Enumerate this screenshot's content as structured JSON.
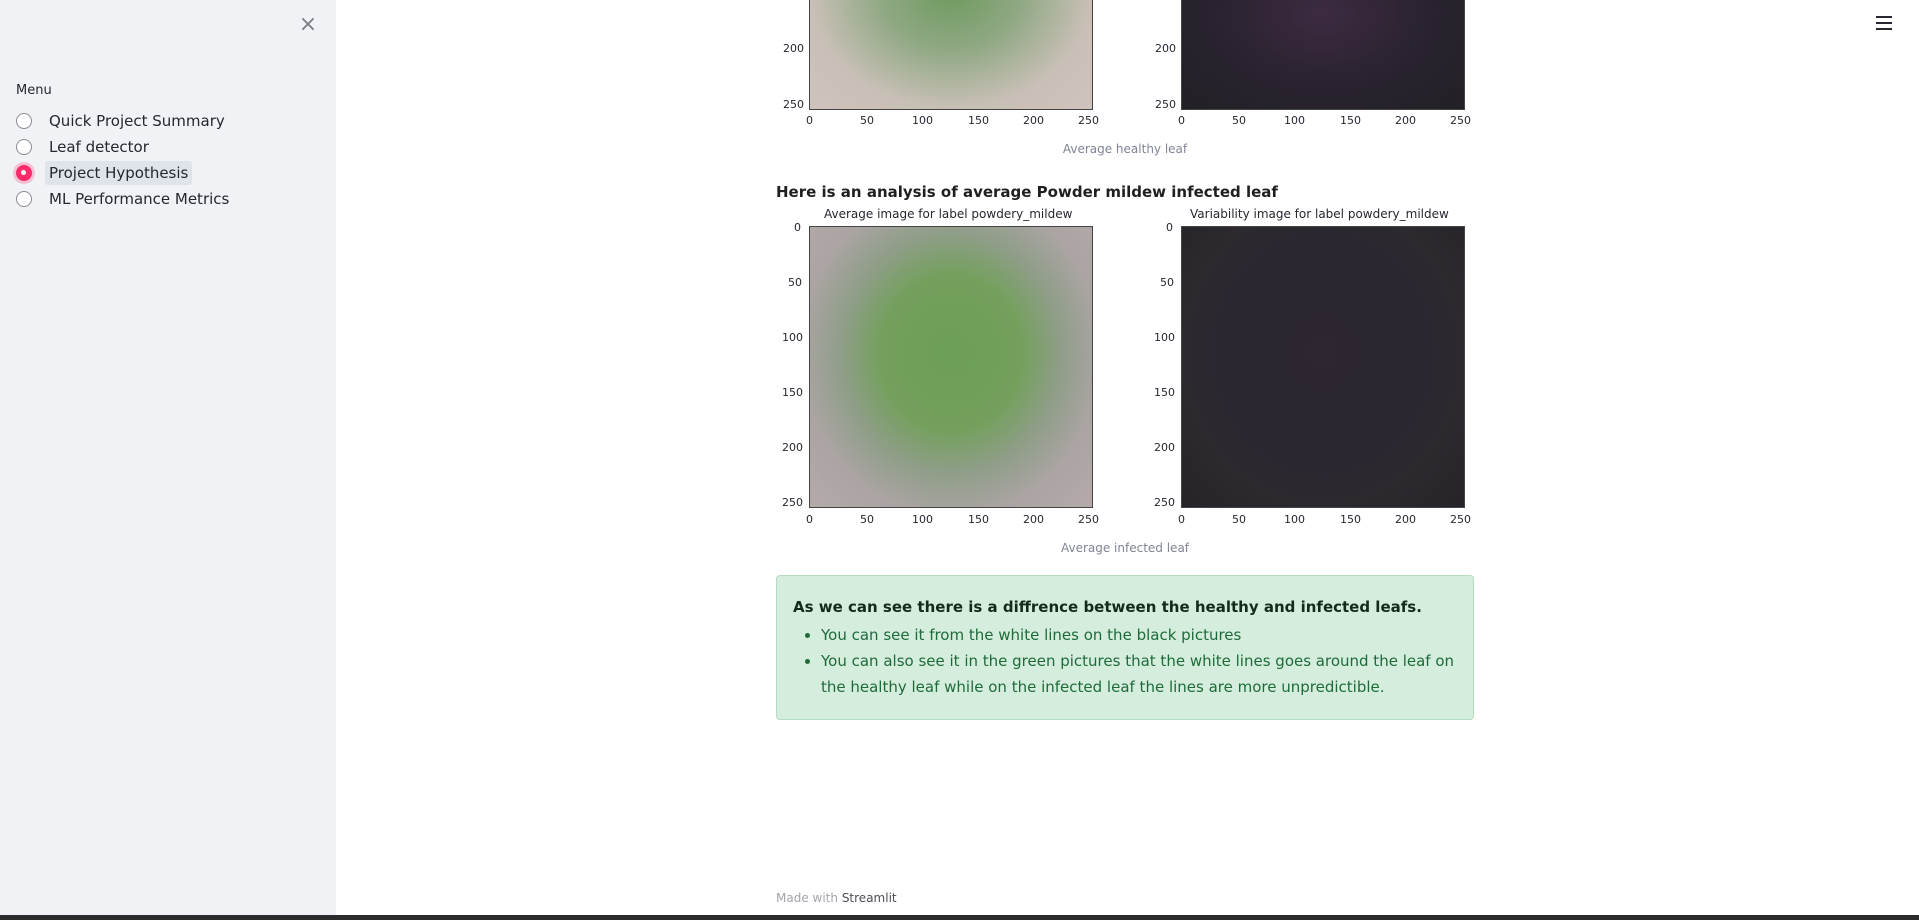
{
  "sidebar": {
    "close_icon": "close-icon",
    "menu_label": "Menu",
    "items": [
      {
        "label": "Quick Project Summary",
        "selected": false
      },
      {
        "label": "Leaf detector",
        "selected": false
      },
      {
        "label": "Project Hypothesis",
        "selected": true
      },
      {
        "label": "ML Performance Metrics",
        "selected": false
      }
    ]
  },
  "header": {
    "menu_icon": "hamburger-icon"
  },
  "main": {
    "healthy": {
      "caption": "Average healthy leaf",
      "ticks_y": [
        "200",
        "250"
      ],
      "ticks_x": [
        "0",
        "50",
        "100",
        "150",
        "200",
        "250"
      ]
    },
    "infected": {
      "heading": "Here is an analysis of average Powder mildew infected leaf",
      "left_title": "Average image for label powdery_mildew",
      "right_title": "Variability image for label powdery_mildew",
      "ticks_y": [
        "0",
        "50",
        "100",
        "150",
        "200",
        "250"
      ],
      "ticks_x": [
        "0",
        "50",
        "100",
        "150",
        "200",
        "250"
      ],
      "caption": "Average infected leaf"
    },
    "conclusion": {
      "title": "As we can see there is a diffrence between the healthy and infected leafs.",
      "bullets": [
        "You can see it from the white lines on the black pictures",
        "You can also see it in the green pictures that the white lines goes around the leaf on the healthy leaf while on the infected leaf the lines are more unpredictible."
      ]
    }
  },
  "footer": {
    "prefix": "Made with",
    "link": "Streamlit"
  },
  "colors": {
    "accent": "#ff2b6a",
    "sidebar_bg": "#f0f2f6",
    "success_bg": "#d4eddc"
  }
}
